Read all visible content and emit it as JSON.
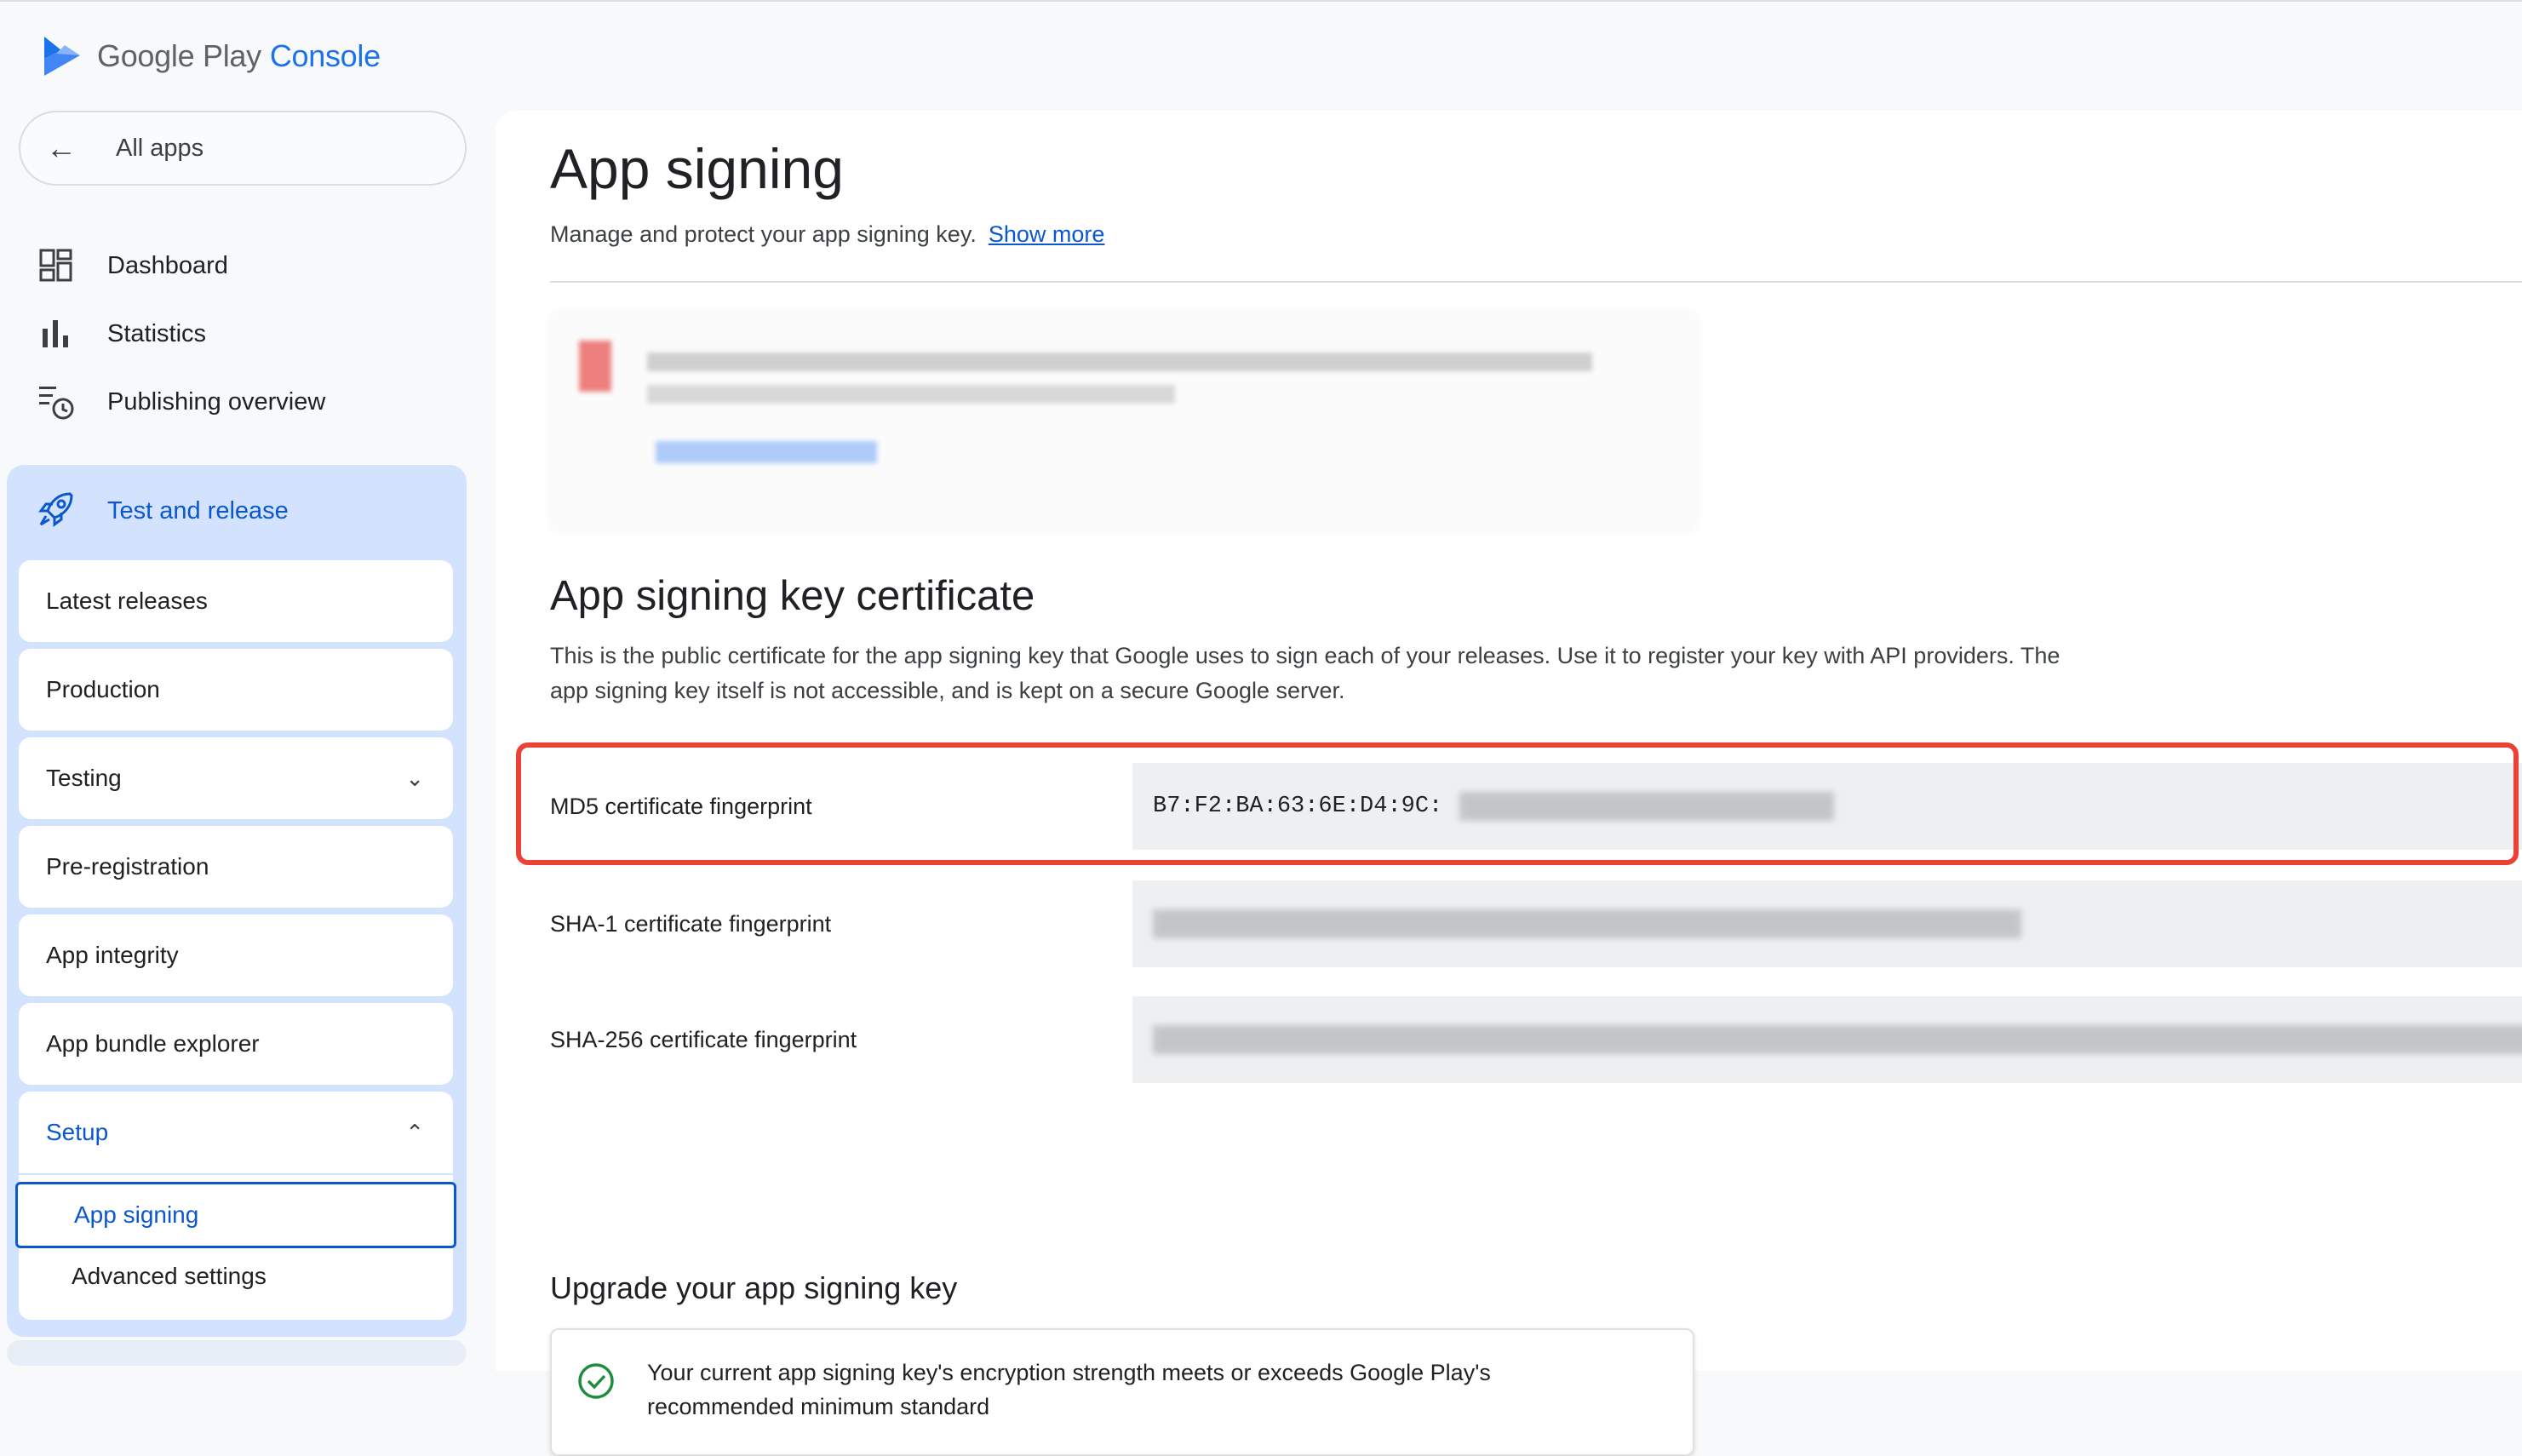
{
  "brand": {
    "google_play": "Google Play",
    "console": "Console"
  },
  "sidebar": {
    "all_apps": "All apps",
    "items": [
      {
        "label": "Dashboard",
        "icon": "dashboard-icon"
      },
      {
        "label": "Statistics",
        "icon": "bar-chart-icon"
      },
      {
        "label": "Publishing overview",
        "icon": "publishing-overview-icon"
      }
    ],
    "group": {
      "label": "Test and release",
      "icon": "rocket-icon"
    },
    "subitems": [
      "Latest releases",
      "Production",
      "Testing",
      "Pre-registration",
      "App integrity",
      "App bundle explorer"
    ],
    "setup": {
      "label": "Setup",
      "children": [
        "App signing",
        "Advanced settings"
      ]
    }
  },
  "main": {
    "title": "App signing",
    "lead": "Manage and protect your app signing key.",
    "show_more": "Show more",
    "cert_title": "App signing key certificate",
    "cert_desc": "This is the public certificate for the app signing key that Google uses to sign each of your releases. Use it to register your key with API providers. The app signing key itself is not accessible, and is kept on a secure Google server.",
    "fingerprints": [
      {
        "label": "MD5 certificate fingerprint",
        "value": "B7:F2:BA:63:6E:D4:9C:"
      },
      {
        "label": "SHA-1 certificate fingerprint",
        "value": ""
      },
      {
        "label": "SHA-256 certificate fingerprint",
        "value": ""
      }
    ],
    "upgrade_title": "Upgrade your app signing key",
    "upgrade_msg": "Your current app signing key's encryption strength meets or exceeds Google Play's recommended minimum standard"
  },
  "colors": {
    "accent": "#0b57d0",
    "highlight": "#ea4335",
    "success": "#1e8e3e"
  }
}
